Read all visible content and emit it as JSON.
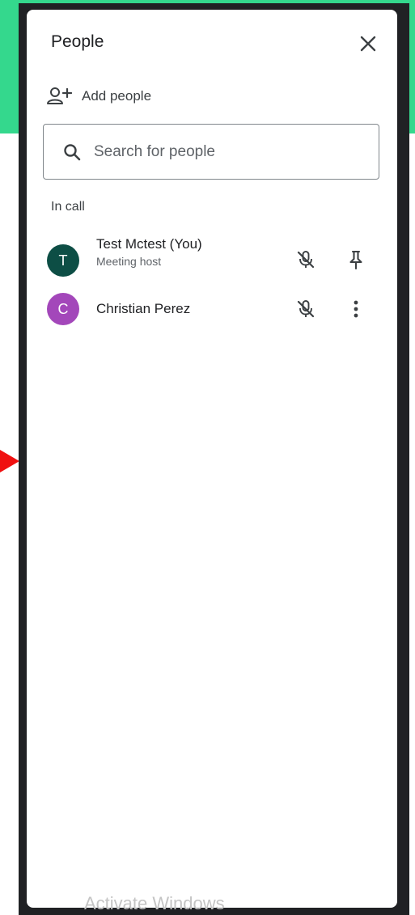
{
  "panel": {
    "title": "People"
  },
  "add_people": {
    "label": "Add people",
    "icon": "person-add-icon"
  },
  "search": {
    "placeholder": "Search for people",
    "value": ""
  },
  "in_call": {
    "label": "In call",
    "participants": [
      {
        "initial": "T",
        "name": "Test Mctest (You)",
        "role": "Meeting host",
        "avatar_color": "#0d4e45",
        "actions": [
          "mic-off-icon",
          "pin-icon"
        ]
      },
      {
        "initial": "C",
        "name": "Christian Perez",
        "role": "",
        "avatar_color": "#a347ba",
        "actions": [
          "mic-off-icon",
          "more-vert-icon"
        ]
      }
    ]
  },
  "colors": {
    "accent_green": "#34d88d",
    "frame": "#202124",
    "arrow": "#f01010"
  },
  "watermark": {
    "text": "Activate Windows"
  }
}
